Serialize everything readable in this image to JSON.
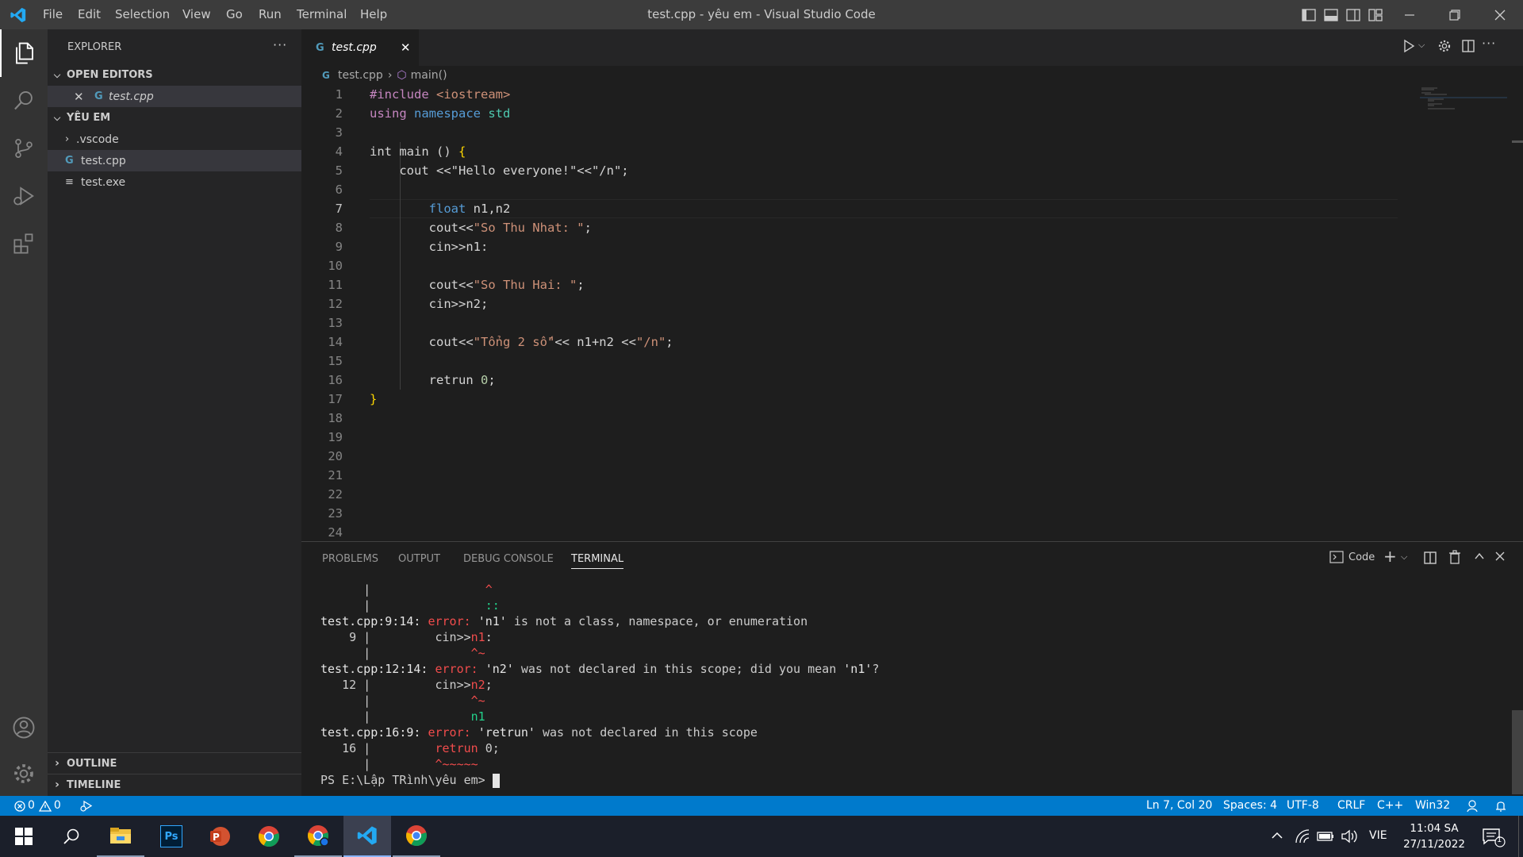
{
  "window": {
    "title": "test.cpp - yêu em - Visual Studio Code",
    "menu": [
      "File",
      "Edit",
      "Selection",
      "View",
      "Go",
      "Run",
      "Terminal",
      "Help"
    ]
  },
  "sidebar": {
    "title": "EXPLORER",
    "open_editors_label": "OPEN EDITORS",
    "open_editor_file": "test.cpp",
    "folder_label": "YÊU EM",
    "files": [
      ".vscode",
      "test.cpp",
      "test.exe"
    ],
    "outline_label": "OUTLINE",
    "timeline_label": "TIMELINE"
  },
  "editor": {
    "tab_label": "test.cpp",
    "breadcrumb_file": "test.cpp",
    "breadcrumb_symbol": "main()",
    "line_count": 24,
    "lines": {
      "l1a": "#include ",
      "l1b": "<iostream>",
      "l2a": "using ",
      "l2b": "namespace ",
      "l2c": "std",
      "l4a": "int ",
      "l4b": "main () ",
      "l4c": "{",
      "l5a": "    cout <<\"Hello everyone!\"<<\"/n\";",
      "l7a": "float ",
      "l7b": "n1,n2",
      "l8a": "cout<<",
      "l8b": "\"So Thu Nhat: \"",
      "l8c": ";",
      "l9": "cin>>n1:",
      "l11a": "cout<<",
      "l11b": "\"So Thu Hai: \"",
      "l11c": ";",
      "l12": "cin>>n2;",
      "l14a": "cout<<",
      "l14b": "\"Tổng 2 số\"",
      "l14c": "<< n1+n2 <<",
      "l14d": "\"/n\"",
      "l14e": ";",
      "l16a": "retrun ",
      "l16b": "0",
      "l16c": ";",
      "l17": "}"
    }
  },
  "panel": {
    "tabs": [
      "PROBLEMS",
      "OUTPUT",
      "DEBUG CONSOLE",
      "TERMINAL"
    ],
    "terminal_name": "Code",
    "terminal": {
      "t1a": "      |",
      "t1b": "                ^",
      "t2a": "      |",
      "t2b": "                ::",
      "t3a": "test.cpp:9:14: ",
      "t3b": "error: ",
      "t3c": "'n1'",
      "t3d": " is not a class, namespace, or enumeration",
      "t4a": "    9 |         cin>>",
      "t4b": "n1",
      "t4c": ":",
      "t5a": "      |",
      "t5b": "              ^~",
      "t6a": "test.cpp:12:14: ",
      "t6b": "error: ",
      "t6c": "'n2'",
      "t6d": " was not declared in this scope; did you mean ",
      "t6e": "'n1'",
      "t6f": "?",
      "t7a": "   12 |         cin>>",
      "t7b": "n2",
      "t7c": ";",
      "t8a": "      |",
      "t8b": "              ^~",
      "t9a": "      |",
      "t9b": "              n1",
      "t10a": "test.cpp:16:9: ",
      "t10b": "error: ",
      "t10c": "'retrun'",
      "t10d": " was not declared in this scope",
      "t11a": "   16 |         ",
      "t11b": "retrun",
      "t11c": " 0;",
      "t12a": "      |",
      "t12b": "         ^~~~~~",
      "prompt": "PS E:\\Lập TRình\\yêu em> "
    }
  },
  "statusbar": {
    "errors": "0",
    "warnings": "0",
    "position": "Ln 7, Col 20",
    "spaces": "Spaces: 4",
    "encoding": "UTF-8",
    "eol": "CRLF",
    "language": "C++",
    "platform": "Win32"
  },
  "taskbar": {
    "language": "VIE",
    "time": "11:04 SA",
    "date": "27/11/2022",
    "notifications": "1"
  },
  "colors": {
    "accent": "#007acc",
    "error": "#f14c4c"
  }
}
